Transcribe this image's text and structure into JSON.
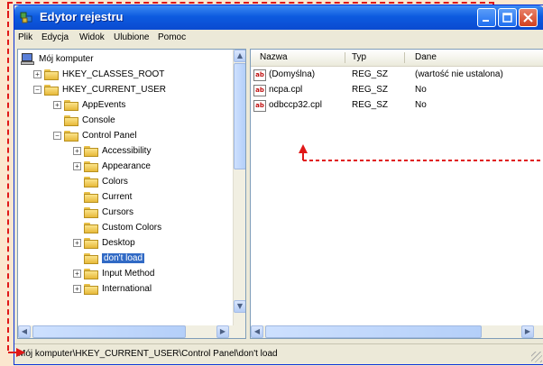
{
  "window": {
    "title": "Edytor rejestru"
  },
  "menu": [
    "Plik",
    "Edycja",
    "Widok",
    "Ulubione",
    "Pomoc"
  ],
  "tree": {
    "root": "Mój komputer",
    "items": [
      {
        "label": "HKEY_CLASSES_ROOT",
        "expander": "+"
      },
      {
        "label": "HKEY_CURRENT_USER",
        "expander": "−"
      },
      {
        "label": "AppEvents",
        "expander": "+"
      },
      {
        "label": "Console",
        "expander": ""
      },
      {
        "label": "Control Panel",
        "expander": "−"
      },
      {
        "label": "Accessibility",
        "expander": "+"
      },
      {
        "label": "Appearance",
        "expander": "+"
      },
      {
        "label": "Colors",
        "expander": ""
      },
      {
        "label": "Current",
        "expander": ""
      },
      {
        "label": "Cursors",
        "expander": ""
      },
      {
        "label": "Custom Colors",
        "expander": ""
      },
      {
        "label": "Desktop",
        "expander": "+"
      },
      {
        "label": "don't load",
        "expander": "",
        "selected": true
      },
      {
        "label": "Input Method",
        "expander": "+"
      },
      {
        "label": "International",
        "expander": "+"
      }
    ]
  },
  "list": {
    "columns": [
      "Nazwa",
      "Typ",
      "Dane"
    ],
    "rows": [
      {
        "name": "(Domyślna)",
        "type": "REG_SZ",
        "data": "(wartość nie ustalona)"
      },
      {
        "name": "ncpa.cpl",
        "type": "REG_SZ",
        "data": "No"
      },
      {
        "name": "odbccp32.cpl",
        "type": "REG_SZ",
        "data": "No"
      }
    ]
  },
  "status": "Mój komputer\\HKEY_CURRENT_USER\\Control Panel\\don't load",
  "colors": {
    "accent_red": "#e01818",
    "selection": "#316ac5",
    "titlebar": "#0d5be0"
  }
}
